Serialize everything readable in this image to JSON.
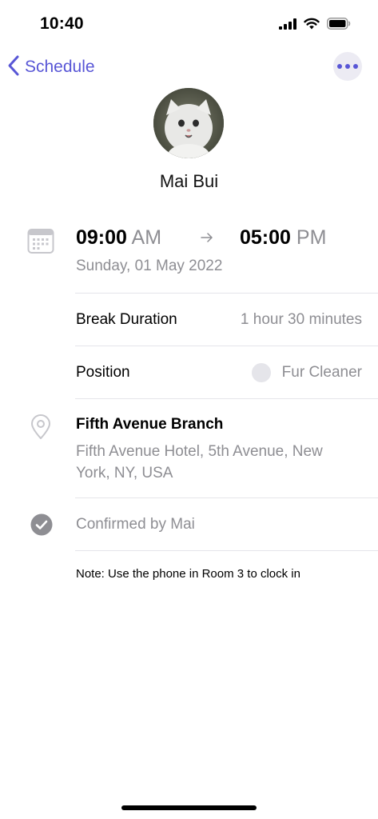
{
  "status_bar": {
    "time": "10:40",
    "icons": [
      "cellular-signal-icon",
      "wifi-icon",
      "battery-icon"
    ]
  },
  "nav": {
    "back_label": "Schedule",
    "back_icon": "chevron-left-icon",
    "more_icon": "ellipsis-icon"
  },
  "profile": {
    "name": "Mai Bui",
    "avatar": "cat-photo-avatar"
  },
  "shift": {
    "start_time": "09:00",
    "start_period": "AM",
    "arrow": "→",
    "end_time": "05:00",
    "end_period": "PM",
    "date": "Sunday, 01 May 2022"
  },
  "details": {
    "break_label": "Break Duration",
    "break_value": "1 hour 30 minutes",
    "position_label": "Position",
    "position_value": "Fur Cleaner"
  },
  "location": {
    "title": "Fifth Avenue Branch",
    "address": "Fifth Avenue Hotel, 5th Avenue, New York, NY, USA"
  },
  "status": {
    "text": "Confirmed by Mai"
  },
  "note": {
    "text": "Note: Use the phone in Room 3 to clock in"
  },
  "colors": {
    "accent": "#5856d6",
    "secondary_text": "#8e8e93",
    "divider": "#e5e5ea",
    "icon_gray": "#c7c7cc"
  }
}
